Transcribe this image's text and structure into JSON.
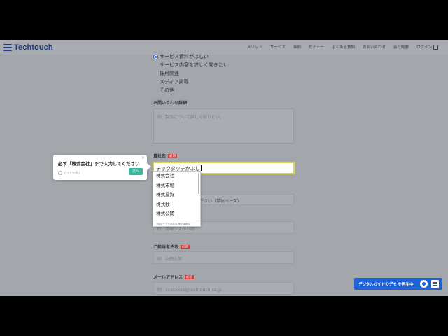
{
  "brand": {
    "name": "Techtouch",
    "color": "#1f3d7a"
  },
  "nav": {
    "links": [
      "メリット",
      "サービス",
      "事例",
      "セミナー",
      "よくある質問",
      "お問い合わせ",
      "会社概要"
    ],
    "login": "ログイン"
  },
  "form": {
    "radio_options": [
      {
        "label": "サービス資料がほしい",
        "selected": true
      },
      {
        "label": "サービス内容を詳しく聞きたい",
        "selected": false
      },
      {
        "label": "採用関連",
        "selected": false
      },
      {
        "label": "メディア掲載",
        "selected": false
      },
      {
        "label": "その他",
        "selected": false
      }
    ],
    "inquiry_label": "お問い合わせ詳細",
    "inquiry_placeholder": "例）製品について詳しく知りたい。",
    "company_label": "貴社名",
    "required_badge": "必須",
    "company_value_prefix": "テックタッチ",
    "company_value_composing": "かぶし",
    "department_select_text": "ださい（単体ベース）",
    "department_placeholder": "例）情報システム部",
    "name_label": "ご担当者氏名",
    "name_placeholder": "例）山田太郎",
    "email_label": "メールアドレス",
    "email_placeholder": "例）xxxxxxxx@techtouch.co.jp"
  },
  "ime": {
    "candidates": [
      "株式会社",
      "株式市場",
      "株式投資",
      "株式数",
      "株式公開"
    ],
    "footer": "Tabキーで予測変換 確定後解除"
  },
  "guide_tooltip": {
    "message": "必ず「株式会社」まで入力してください",
    "opt_out": "ガイドを停止",
    "next": "次へ",
    "close": "×"
  },
  "demo_button": {
    "label": "デジタルガイドのデモ を再生中",
    "color": "#1e63d6"
  }
}
